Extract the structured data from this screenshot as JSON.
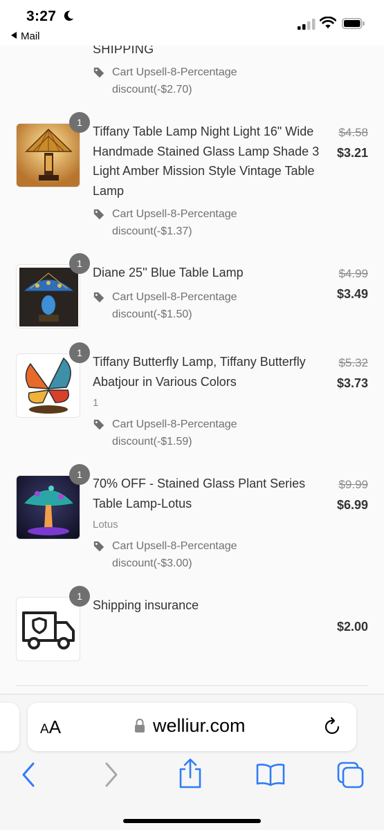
{
  "status_bar": {
    "time": "3:27",
    "back_app": "Mail"
  },
  "cart": {
    "top_fragment": {
      "title_tail": "SHIPPING",
      "discount": "Cart Upsell-8-Percentage discount(-$2.70)"
    },
    "items": [
      {
        "title": "Tiffany Table Lamp Night Light 16\" Wide Handmade Stained Glass Lamp Shade 3 Light Amber Mission Style Vintage Table Lamp",
        "quantity": "1",
        "variant": "",
        "discount": "Cart Upsell-8-Percentage discount(-$1.37)",
        "price_original": "$4.58",
        "price_final": "$3.21",
        "image": "amber-tiffany-lamp"
      },
      {
        "title": "Diane 25'' Blue Table Lamp",
        "quantity": "1",
        "variant": "",
        "discount": "Cart Upsell-8-Percentage discount(-$1.50)",
        "price_original": "$4.99",
        "price_final": "$3.49",
        "image": "blue-dragonfly-lamp"
      },
      {
        "title": "Tiffany Butterfly Lamp, Tiffany Butterfly Abatjour in Various Colors",
        "quantity": "1",
        "variant": "1",
        "discount": "Cart Upsell-8-Percentage discount(-$1.59)",
        "price_original": "$5.32",
        "price_final": "$3.73",
        "image": "butterfly-lamp"
      },
      {
        "title": "70% OFF - Stained Glass Plant Series Table Lamp-Lotus",
        "quantity": "1",
        "variant": "Lotus",
        "discount": "Cart Upsell-8-Percentage discount(-$3.00)",
        "price_original": "$9.99",
        "price_final": "$6.99",
        "image": "mushroom-lotus-lamp"
      },
      {
        "title": "Shipping insurance",
        "quantity": "1",
        "variant": "",
        "discount": "",
        "price_original": "",
        "price_final": "$2.00",
        "image": "delivery-truck-icon"
      }
    ]
  },
  "browser": {
    "aa_label_small": "A",
    "aa_label_large": "A",
    "url": "welliur.com"
  },
  "colors": {
    "accent": "#2f7cf6",
    "badge": "#707070",
    "text": "#333333",
    "muted": "#707070"
  }
}
